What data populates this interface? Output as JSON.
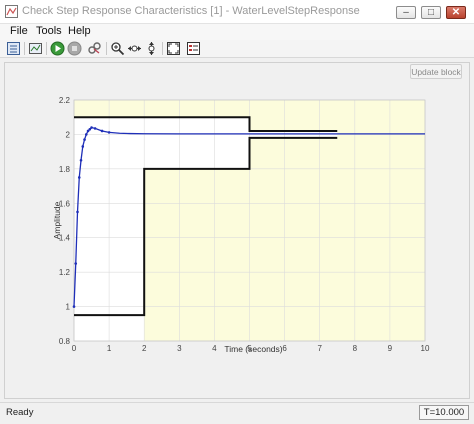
{
  "window": {
    "title": "Check Step Response Characteristics [1] - WaterLevelStepResponse",
    "minimize_glyph": "–",
    "maximize_glyph": "□",
    "close_glyph": "✕"
  },
  "menu": {
    "items": [
      "File",
      "Tools",
      "Help"
    ]
  },
  "toolbar": {
    "icons": [
      "library-icon",
      "print-icon",
      "run-icon",
      "stop-icon",
      "link-icon",
      "zoom-in-icon",
      "zoom-x-icon",
      "zoom-y-icon",
      "fit-icon",
      "parameters-icon"
    ]
  },
  "update_button": {
    "label": "Update block"
  },
  "status": {
    "text": "Ready",
    "time": "T=10.000"
  },
  "colors": {
    "feasible_bg": "#fcfcdc",
    "bound_line": "#111111",
    "response_line": "#1f2fb8",
    "plot_bg": "#ffffff"
  },
  "chart_data": {
    "type": "line",
    "xlabel": "Time (seconds)",
    "ylabel": "Amplitude",
    "xlim": [
      0,
      10
    ],
    "ylim": [
      0.8,
      2.2
    ],
    "xticks": [
      "0",
      "1",
      "2",
      "3",
      "4",
      "5",
      "6",
      "7",
      "8",
      "9",
      "10"
    ],
    "yticks": [
      "0.8",
      "1",
      "1.2",
      "1.4",
      "1.6",
      "1.8",
      "2",
      "2.2"
    ],
    "grid": true,
    "series": [
      {
        "x": [
          0,
          0.05,
          0.1,
          0.15,
          0.2,
          0.25,
          0.3,
          0.35,
          0.4,
          0.45,
          0.5,
          0.6,
          0.8,
          1.0,
          1.3,
          1.6,
          2.0,
          3,
          4,
          5,
          6,
          7,
          8,
          9,
          10
        ],
        "y": [
          1.0,
          1.25,
          1.55,
          1.75,
          1.85,
          1.93,
          1.97,
          2.0,
          2.02,
          2.03,
          2.04,
          2.035,
          2.02,
          2.012,
          2.007,
          2.005,
          2.004,
          2.003,
          2.003,
          2.003,
          2.003,
          2.003,
          2.003,
          2.003,
          2.003
        ]
      }
    ],
    "bounds": {
      "upper": {
        "x": [
          0,
          5,
          5,
          7.5
        ],
        "y": [
          2.1,
          2.1,
          2.02,
          2.02
        ]
      },
      "lower": {
        "x": [
          0,
          2,
          2,
          5,
          5,
          7.5
        ],
        "y": [
          0.95,
          0.95,
          1.8,
          1.8,
          1.98,
          1.98
        ]
      }
    }
  }
}
